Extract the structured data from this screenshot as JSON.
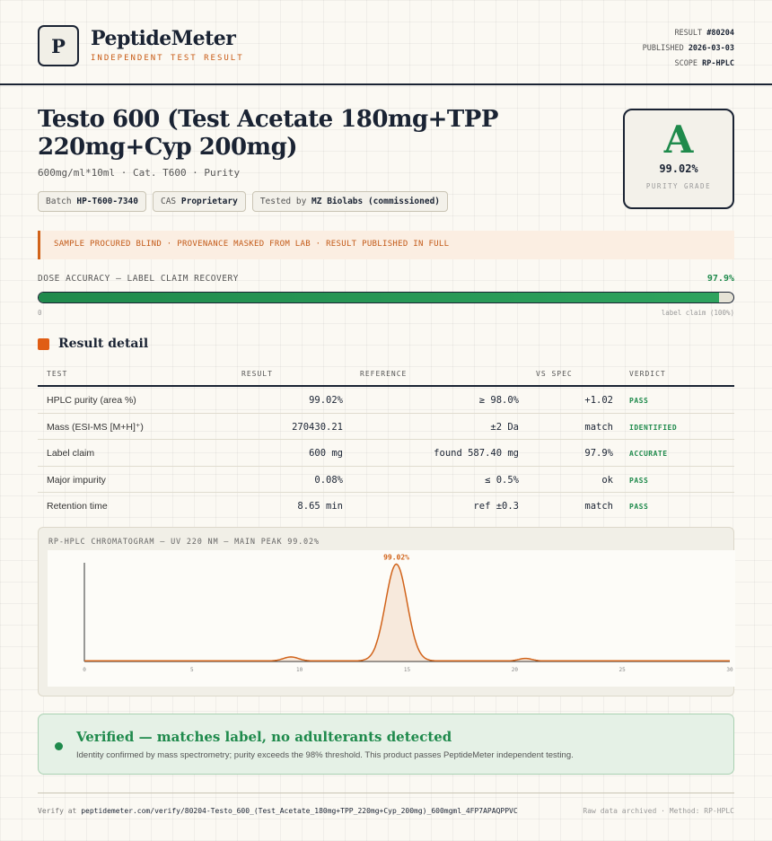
{
  "header": {
    "logo_letter": "P",
    "brand": "PeptideMeter",
    "tagline": "INDEPENDENT TEST RESULT",
    "result_label": "RESULT",
    "result_id": "#80204",
    "published_label": "PUBLISHED",
    "published_date": "2026-03-03",
    "scope_label": "SCOPE",
    "scope_value": "RP-HPLC"
  },
  "product": {
    "title": "Testo 600 (Test Acetate 180mg+TPP 220mg+Cyp 200mg)",
    "subtitle": "600mg/ml*10ml · Cat. T600 · Purity",
    "chips": [
      {
        "label": "Batch",
        "value": "HP-T600-7340"
      },
      {
        "label": "CAS",
        "value": "Proprietary"
      },
      {
        "label": "Tested by",
        "value": "MZ Biolabs (commissioned)"
      }
    ]
  },
  "grade": {
    "letter": "A",
    "purity": "99.02%",
    "label": "PURITY GRADE",
    "color": "#1f8a4c"
  },
  "notice": "SAMPLE PROCURED BLIND · PROVENANCE MASKED FROM LAB · RESULT PUBLISHED IN FULL",
  "dose": {
    "label": "DOSE ACCURACY — LABEL CLAIM RECOVERY",
    "value_text": "97.9%",
    "fraction": 0.979,
    "min_label": "0",
    "max_label": "label claim (100%)"
  },
  "section_title": "Result detail",
  "table": {
    "headers": {
      "test": "TEST",
      "result": "RESULT",
      "reference": "REFERENCE",
      "vs": "VS SPEC",
      "verdict": "VERDICT"
    },
    "rows": [
      {
        "test": "HPLC purity (area %)",
        "result": "99.02%",
        "reference": "≥ 98.0%",
        "vs": "+1.02",
        "verdict": "PASS"
      },
      {
        "test": "Mass (ESI-MS [M+H]⁺)",
        "result": "270430.21",
        "reference": "±2 Da",
        "vs": "match",
        "verdict": "IDENTIFIED"
      },
      {
        "test": "Label claim",
        "result": "600 mg",
        "reference": "found 587.40 mg",
        "vs": "97.9%",
        "verdict": "ACCURATE"
      },
      {
        "test": "Major impurity",
        "result": "0.08%",
        "reference": "≤ 0.5%",
        "vs": "ok",
        "verdict": "PASS"
      },
      {
        "test": "Retention time",
        "result": "8.65 min",
        "reference": "ref ±0.3",
        "vs": "match",
        "verdict": "PASS"
      }
    ]
  },
  "chart_data": {
    "type": "line",
    "title": "RP-HPLC CHROMATOGRAM — UV 220 NM — MAIN PEAK 99.02%",
    "xlim": [
      0,
      30
    ],
    "ylim": [
      0,
      100
    ],
    "x_ticks": [
      "0",
      "5",
      "10",
      "15",
      "20",
      "25",
      "30"
    ],
    "peaks": [
      {
        "x": 9.6,
        "height": 4.0,
        "width": 0.35
      },
      {
        "x": 14.5,
        "height": 98.0,
        "width": 0.5
      },
      {
        "x": 20.5,
        "height": 2.5,
        "width": 0.3
      }
    ],
    "main_peak_label": "99.02%",
    "line_color": "#d1631a"
  },
  "verified": {
    "title": "Verified — matches label, no adulterants detected",
    "description": "Identity confirmed by mass spectrometry; purity exceeds the 98% threshold. This product passes PeptideMeter independent testing."
  },
  "footer": {
    "verify_prefix": "Verify at",
    "verify_url": "peptidemeter.com/verify/80204-Testo_600_(Test_Acetate_180mg+TPP_220mg+Cyp_200mg)_600mgml_4FP7APAQPPVC",
    "right": "Raw data archived · Method: RP-HPLC"
  }
}
